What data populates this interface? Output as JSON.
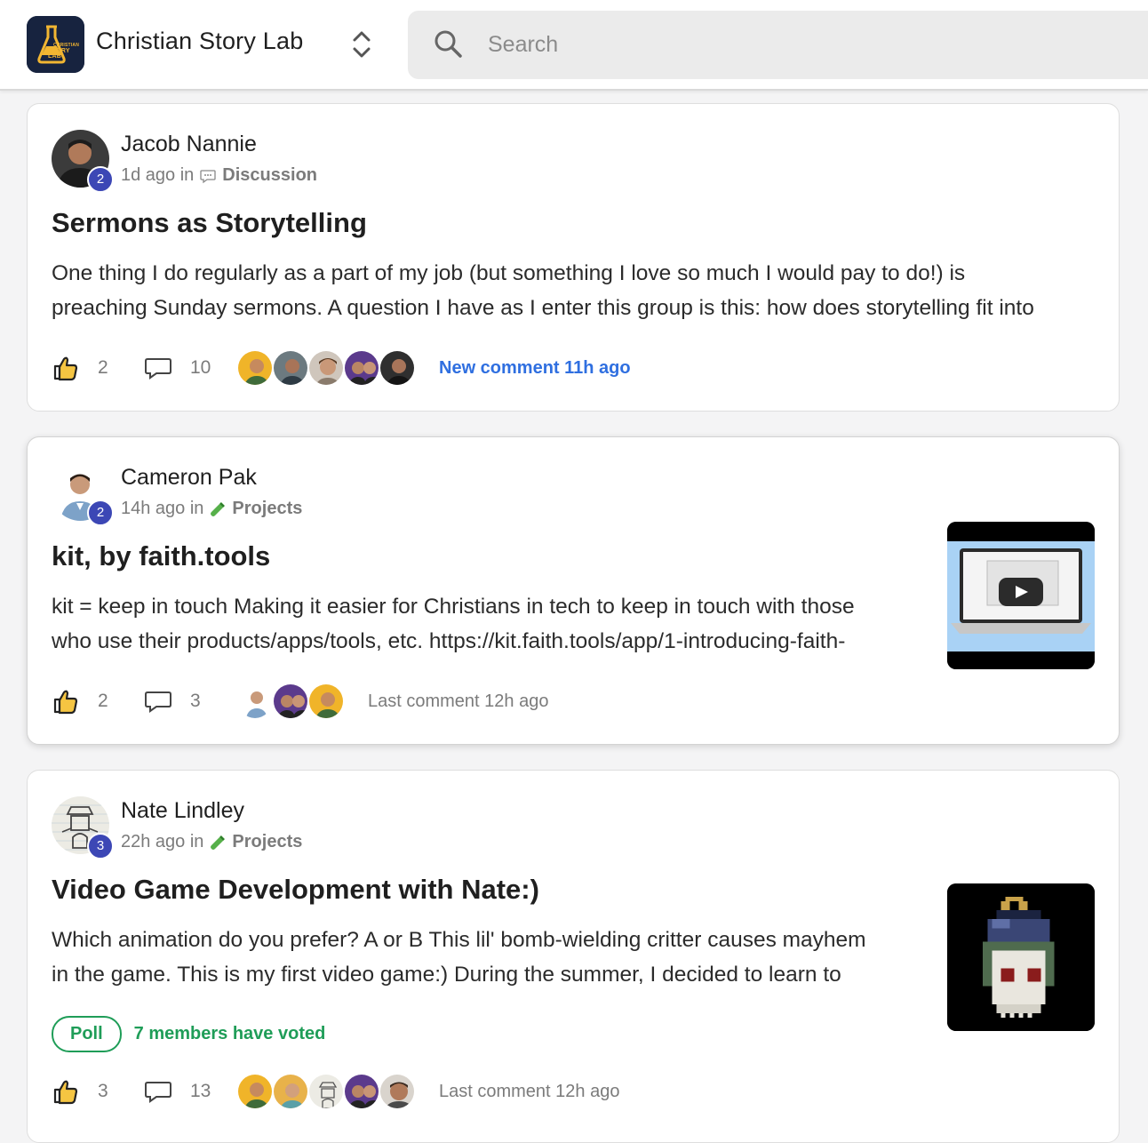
{
  "header": {
    "group_name": "Christian Story Lab",
    "logo_text_top": "CHRISTIAN",
    "logo_text_bottom": "STORY LAB",
    "search_placeholder": "Search"
  },
  "colors": {
    "accent_blue": "#2f6fe0",
    "level_badge": "#3c47b5",
    "poll_green": "#1f9d58"
  },
  "posts": [
    {
      "author": "Jacob Nannie",
      "level": "2",
      "time": "1d ago in",
      "space_icon": "speech-bubble-icon",
      "space": "Discussion",
      "title": "Sermons as Storytelling",
      "body_line1": "One thing I do regularly as a part of my job (but something I love so much I would pay to do!) is",
      "body_line2": "preaching Sunday sermons. A question I have as I enter this group is this: how does storytelling fit into",
      "likes": "2",
      "comments": "10",
      "activity": "New comment 11h ago"
    },
    {
      "author": "Cameron Pak",
      "level": "2",
      "time": "14h ago in",
      "space_icon": "test-tube-icon",
      "space": "Projects",
      "title": "kit, by faith.tools",
      "body_line1": "kit = keep in touch Making it easier for Christians in tech to keep in touch with those",
      "body_line2": "who use their products/apps/tools, etc. https://kit.faith.tools/app/1-introducing-faith-",
      "likes": "2",
      "comments": "3",
      "activity": "Last comment 12h ago"
    },
    {
      "author": "Nate Lindley",
      "level": "3",
      "time": "22h ago in",
      "space_icon": "test-tube-icon",
      "space": "Projects",
      "title": "Video Game Development with Nate:)",
      "body_line1": "Which animation do you prefer? A or B This lil' bomb-wielding critter causes mayhem",
      "body_line2": "in the game. This is my first video game:) During the summer, I decided to learn to",
      "poll_label": "Poll",
      "poll_votes": "7 members have voted",
      "likes": "3",
      "comments": "13",
      "activity": "Last comment 12h ago"
    }
  ]
}
